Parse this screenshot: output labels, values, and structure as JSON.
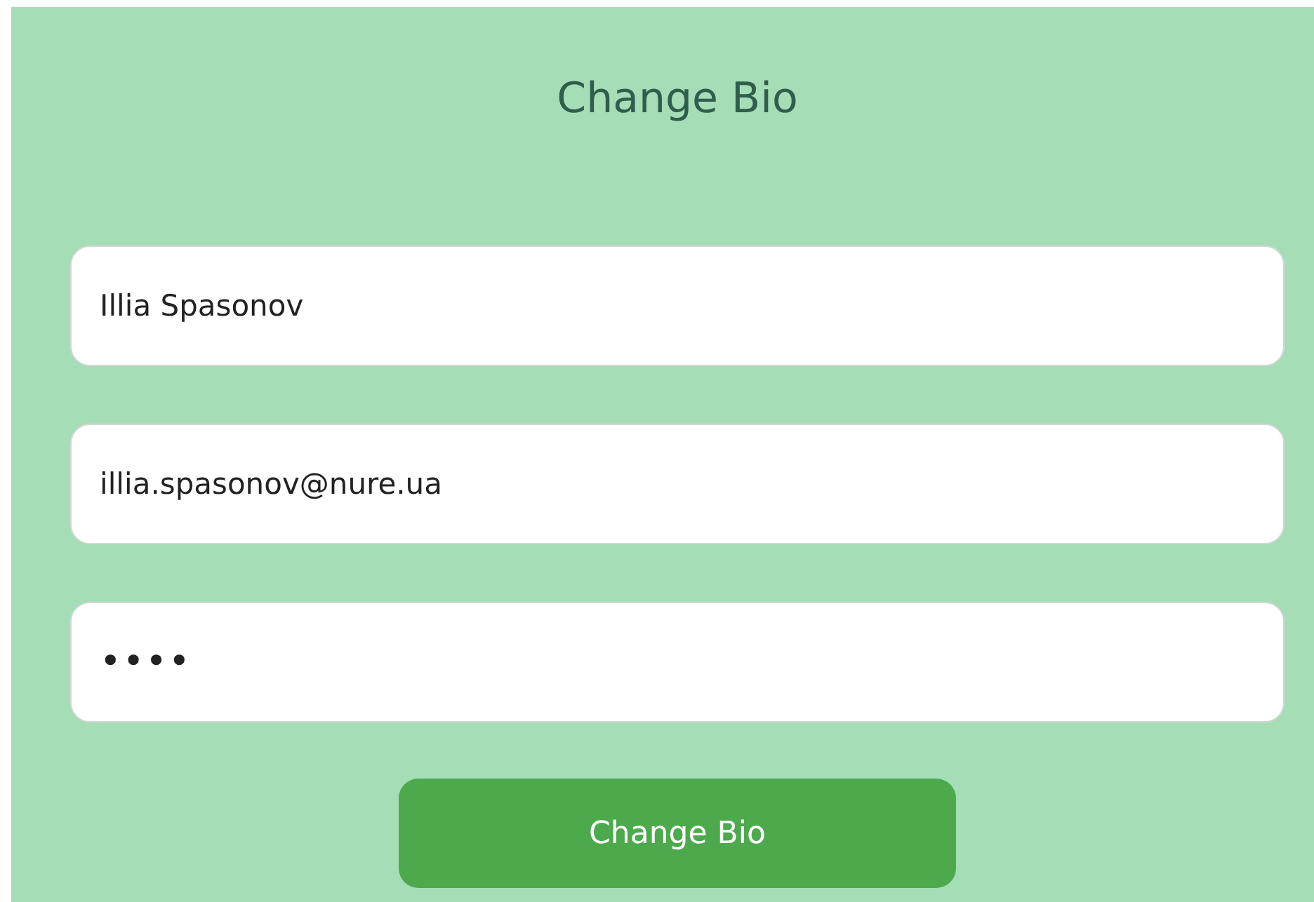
{
  "title": "Change Bio",
  "fields": [
    {
      "kind": "text",
      "value": "Illia Spasonov"
    },
    {
      "kind": "email",
      "value": "illia.spasonov@nure.ua"
    },
    {
      "kind": "password",
      "value": "••••"
    }
  ],
  "submit": {
    "label": "Change Bio"
  }
}
